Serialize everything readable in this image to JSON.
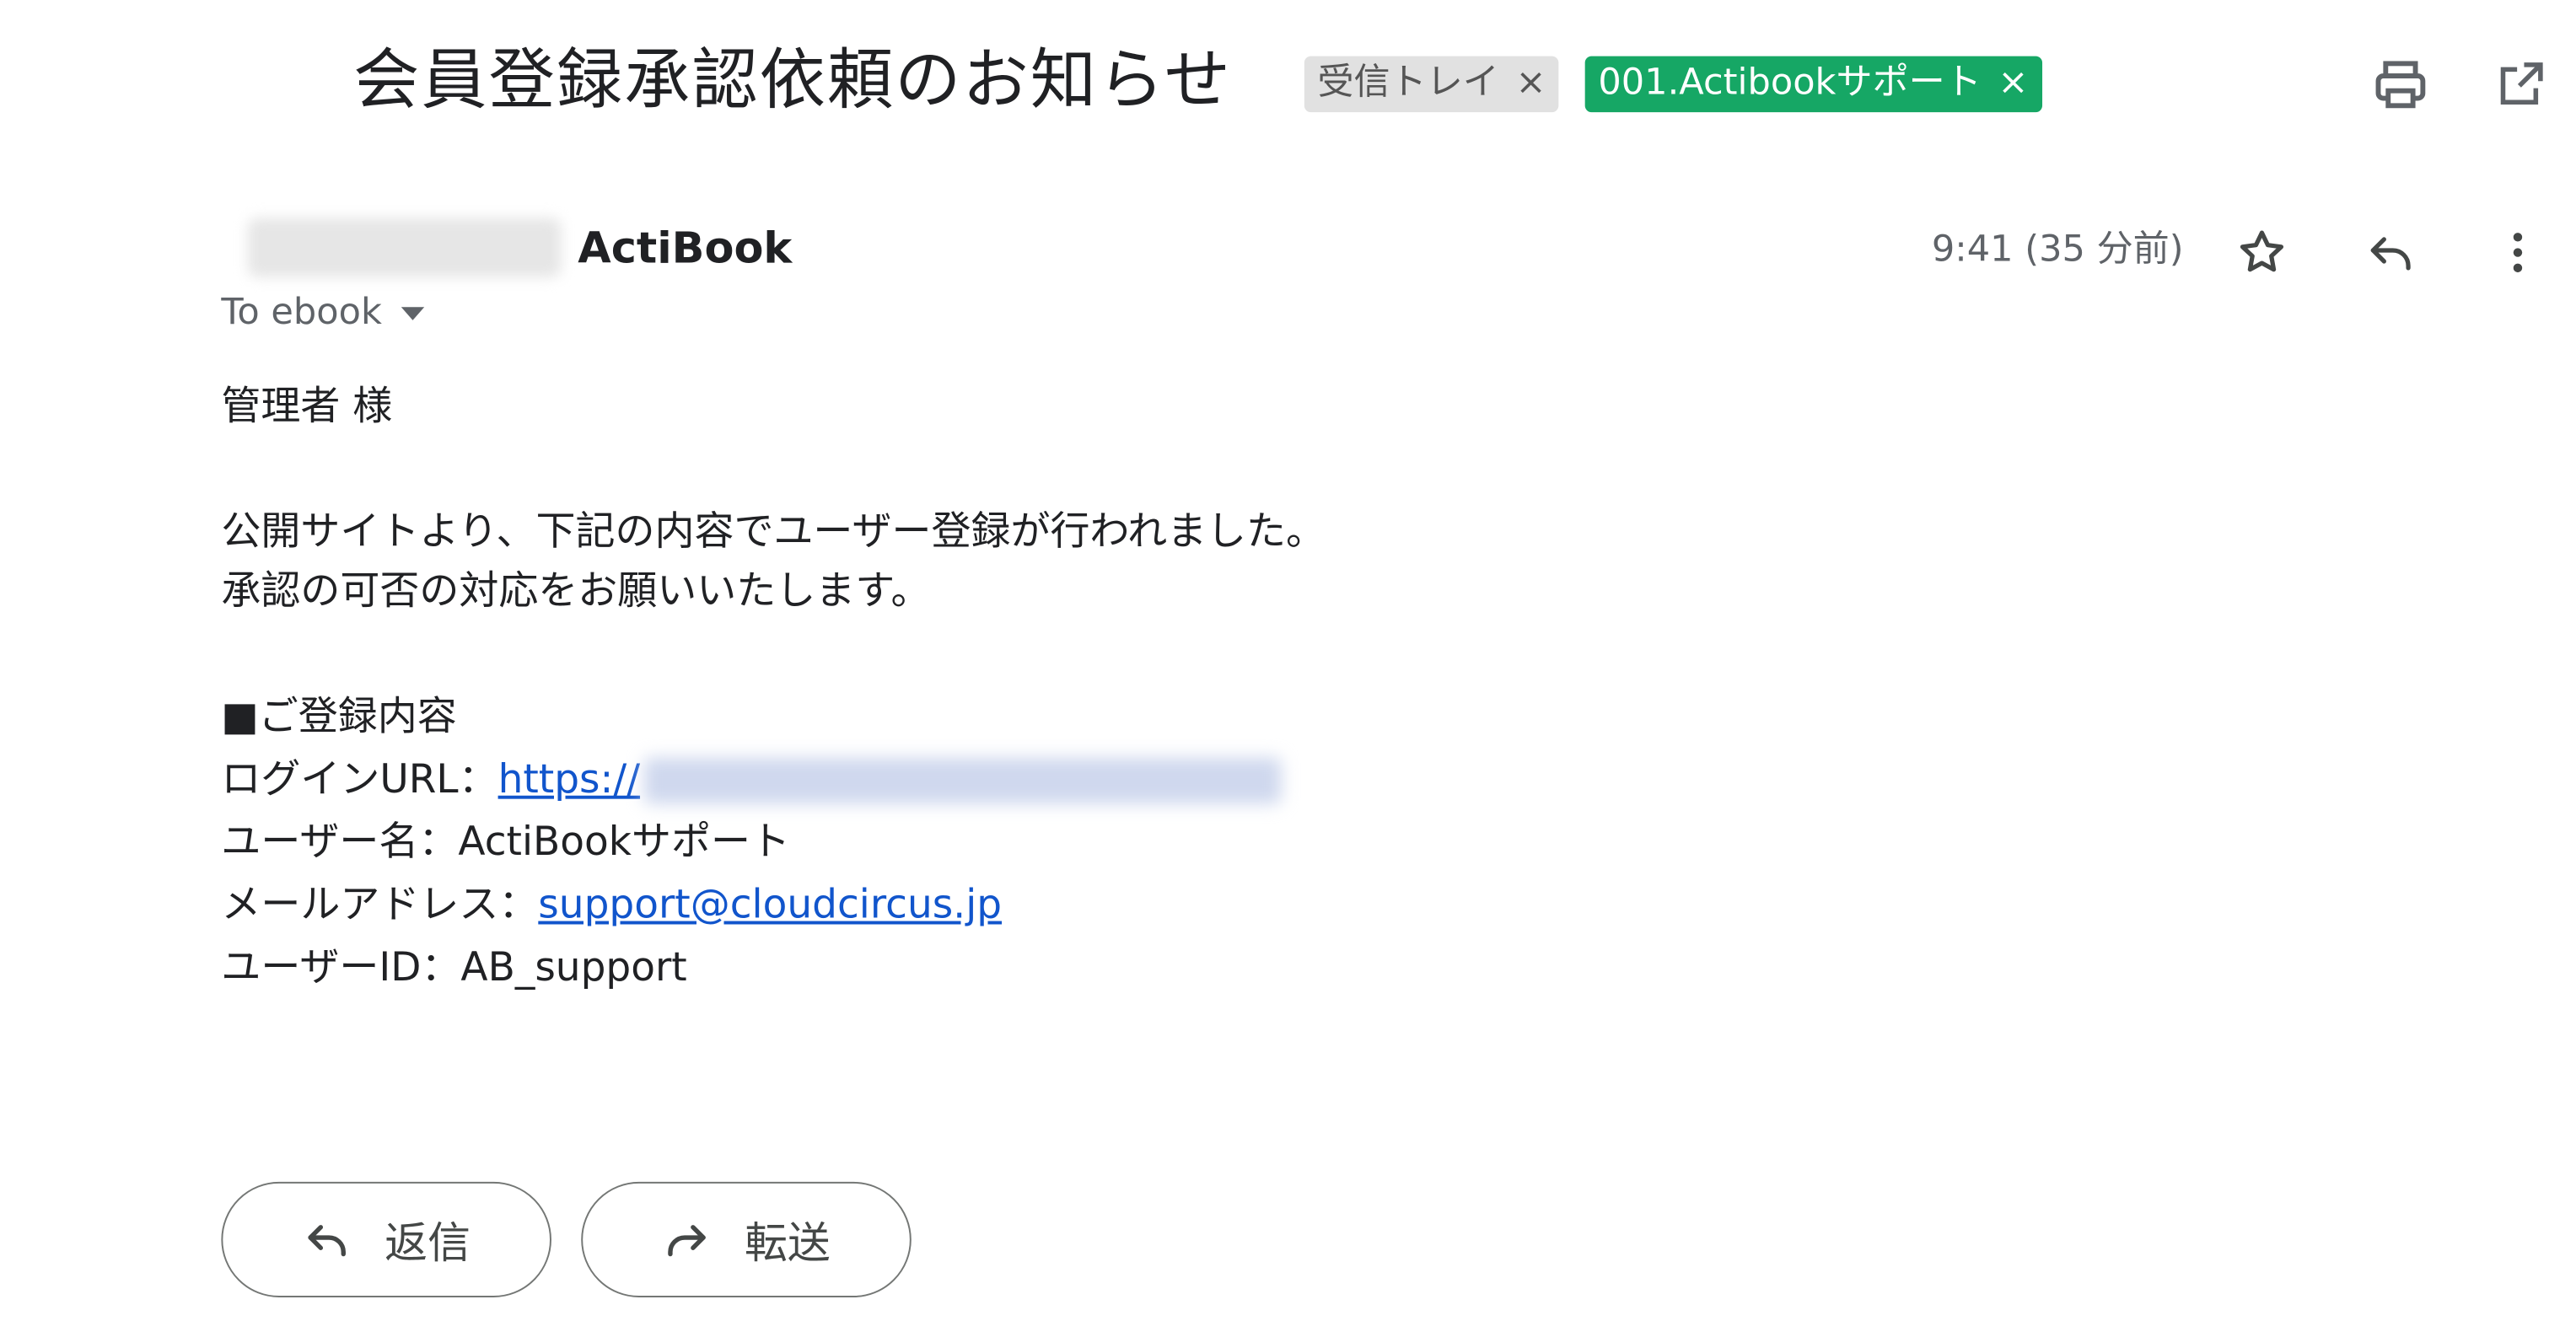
{
  "email": {
    "subject": "会員登録承認依頼のお知らせ",
    "labels": [
      {
        "text": "受信トレイ",
        "remove": "×",
        "color": "#e1e1e1"
      },
      {
        "text": "001.Actibookサポート",
        "remove": "×",
        "color": "#16a765"
      }
    ],
    "sender_name": "ActiBook",
    "to_line": "To ebook",
    "time": "9:41 (35 分前)",
    "body": {
      "greeting": "管理者 様",
      "line1": "公開サイトより、下記の内容でユーザー登録が行われました。",
      "line2": "承認の可否の対応をお願いいたします。",
      "section_heading": "■ご登録内容",
      "login_url_label": "ログインURL：",
      "login_url_value": "https://",
      "user_name_line": "ユーザー名：ActiBookサポート",
      "email_label": "メールアドレス：",
      "email_value": "support@cloudcircus.jp",
      "user_id_line": "ユーザーID：AB_support"
    },
    "footer": {
      "reply_label": "返信",
      "forward_label": "転送"
    }
  },
  "icons": {
    "print": "print-icon",
    "open_new_window": "open-in-new-icon",
    "star": "star-icon",
    "reply": "reply-icon",
    "more": "more-vert-icon",
    "forward": "forward-icon"
  }
}
